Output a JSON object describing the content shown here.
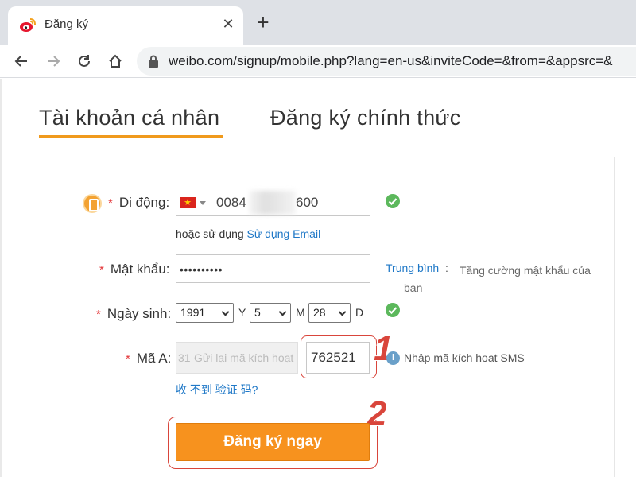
{
  "browser": {
    "tab_title": "Đăng ký",
    "close_glyph": "✕",
    "new_tab_glyph": "+",
    "url": "weibo.com/signup/mobile.php?lang=en-us&inviteCode=&from=&appsrc=&",
    "icons": [
      "back-icon",
      "forward-icon",
      "reload-icon",
      "home-icon",
      "lock-icon",
      "weibo-logo-icon"
    ]
  },
  "tabs": {
    "personal": "Tài khoản cá nhân",
    "official": "Đăng ký chính thức",
    "active": "personal",
    "accent_color": "#f09a1c"
  },
  "form": {
    "required_mark": "*",
    "mobile": {
      "label": "Di động:",
      "prefix": "0084",
      "suffix": "600",
      "country": "Vietnam"
    },
    "alt": {
      "text": "hoặc sử dụng",
      "link": "Sử dụng Email"
    },
    "password": {
      "label": "Mật khẩu:",
      "value": "••••••••••",
      "strength": "Trung bình",
      "sep": ":",
      "tip": "Tăng cường mật khẩu của bạn"
    },
    "birthday": {
      "label": "Ngày sinh:",
      "year": "1991",
      "year_unit": "Y",
      "month": "5",
      "month_unit": "M",
      "day": "28",
      "day_unit": "D"
    },
    "code": {
      "label": "Mã A:",
      "countdown": "31",
      "resend": "Gửi lại mã kích hoạt",
      "value": "762521",
      "hint": "Nhập mã kích hoạt SMS",
      "no_receive": "收 不到 验证 码?"
    },
    "submit": "Đăng ký ngay",
    "submit_color": "#f7921e"
  },
  "annotations": {
    "step1": "1",
    "step2": "2",
    "color": "#d9453b"
  }
}
